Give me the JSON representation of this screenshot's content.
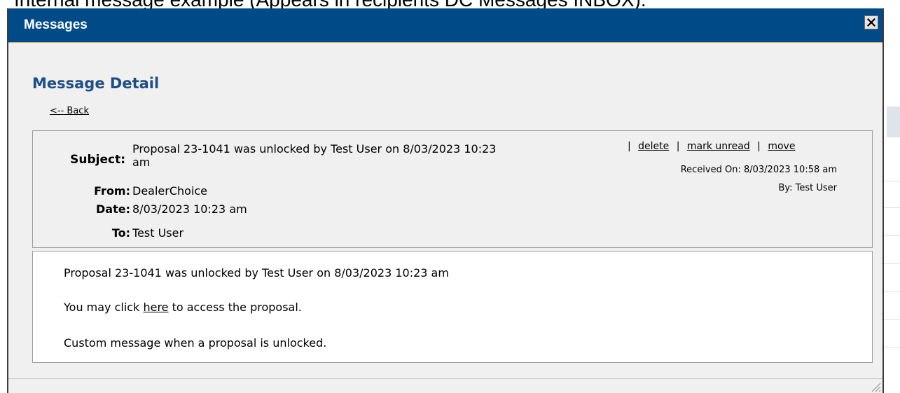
{
  "caption": "Internal message example (Appears in recipients DC Messages INBOX):",
  "window": {
    "title": "Messages",
    "close_label": "Close"
  },
  "page": {
    "heading": "Message Detail",
    "back_label": "<-- Back"
  },
  "message": {
    "subject_label": "Subject:",
    "subject_value": "Proposal 23-1041 was unlocked by Test User on 8/03/2023 10:23 am",
    "from_label": "From:",
    "from_value": "DealerChoice",
    "date_label": "Date:",
    "date_value": "8/03/2023 10:23 am",
    "to_label": "To:",
    "to_value": "Test User",
    "actions": {
      "separator": "|",
      "delete": "delete",
      "mark_unread": "mark unread",
      "move": "move"
    },
    "received_on": "Received On: 8/03/2023 10:58 am",
    "received_by": "By: Test User"
  },
  "body": {
    "line1": "Proposal 23-1041 was unlocked by Test User on 8/03/2023 10:23 am",
    "line2_before": "You may click ",
    "line2_link": "here",
    "line2_after": " to access the proposal.",
    "line3": "Custom message when a proposal is unlocked."
  },
  "colors": {
    "titlebar": "#004b87",
    "heading": "#1f4e84",
    "dialog_bg": "#f0f0f0"
  },
  "icons": {
    "close": "close-icon",
    "resize": "resize-grip-icon"
  }
}
